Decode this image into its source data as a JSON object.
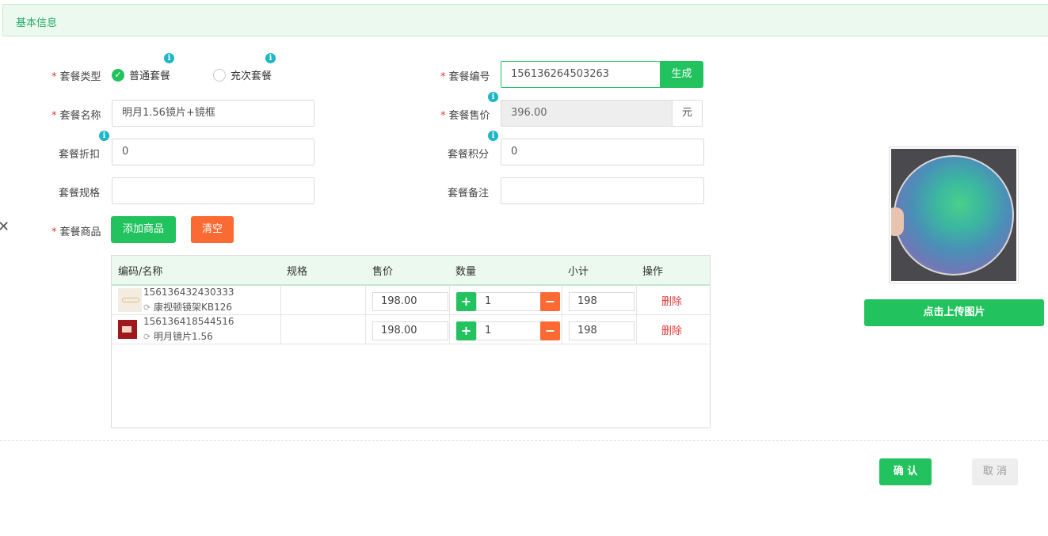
{
  "header": {
    "title": "基本信息"
  },
  "form": {
    "type_label": "套餐类型",
    "type_options": [
      "普通套餐",
      "充次套餐"
    ],
    "type_selected": "普通套餐",
    "code_label": "套餐编号",
    "code_value": "156136264503263",
    "generate_label": "生成",
    "name_label": "套餐名称",
    "name_value": "明月1.56镜片+镜框",
    "price_label": "套餐售价",
    "price_value": "396.00",
    "price_unit": "元",
    "discount_label": "套餐折扣",
    "discount_value": "0",
    "points_label": "套餐积分",
    "points_value": "0",
    "spec_label": "套餐规格",
    "spec_value": "",
    "remark_label": "套餐备注",
    "remark_value": "",
    "goods_label": "套餐商品",
    "add_goods_label": "添加商品",
    "clear_label": "清空"
  },
  "table": {
    "headers": [
      "编码/名称",
      "规格",
      "售价",
      "数量",
      "小计",
      "操作"
    ],
    "rows": [
      {
        "code": "156136432430333",
        "name": "康视顿镜架KB126",
        "spec": "",
        "price": "198.00",
        "qty": "1",
        "subtotal": "198",
        "action": "删除"
      },
      {
        "code": "156136418544516",
        "name": "明月镜片1.56",
        "spec": "",
        "price": "198.00",
        "qty": "1",
        "subtotal": "198",
        "action": "删除"
      }
    ]
  },
  "upload": {
    "label": "点击上传图片"
  },
  "footer": {
    "confirm_label": "确 认",
    "cancel_label": "取 消"
  },
  "colors": {
    "accent": "#22c35e",
    "warning": "#fb6a33",
    "header_bg": "#ebf9ee",
    "info": "#1eb7c7"
  }
}
